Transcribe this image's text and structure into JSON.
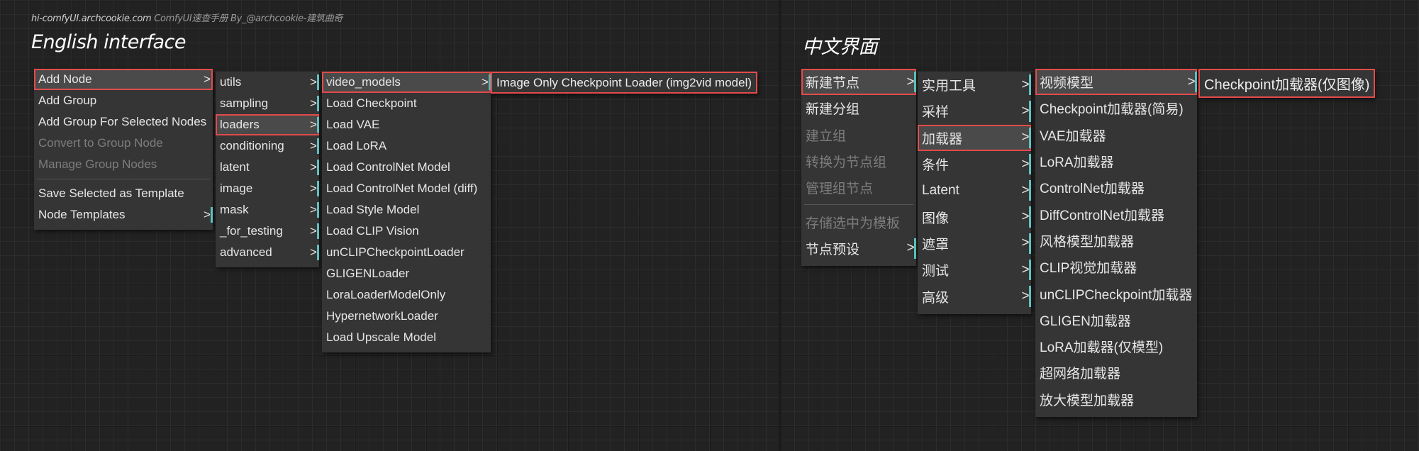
{
  "credit": {
    "site": "hi-comfyUI.archcookie.com",
    "rest": " ComfyUI速查手册  By_@archcookie-建筑曲奇"
  },
  "english": {
    "heading": "English interface",
    "context_menu": [
      {
        "label": "Add Node",
        "arrow": ">",
        "highlighted": true,
        "boxed": true
      },
      {
        "label": "Add Group"
      },
      {
        "label": "Add Group For Selected Nodes"
      },
      {
        "label": "Convert to Group Node",
        "disabled": true
      },
      {
        "label": "Manage Group Nodes",
        "disabled": true
      },
      {
        "label": "Save Selected as Template"
      },
      {
        "label": "Node Templates",
        "arrow": ">",
        "bar": true
      }
    ],
    "categories": [
      {
        "label": "utils",
        "arrow": ">",
        "bar": true
      },
      {
        "label": "sampling",
        "arrow": ">",
        "bar": true
      },
      {
        "label": "loaders",
        "arrow": ">",
        "bar": true,
        "boxed": true,
        "highlighted": true
      },
      {
        "label": "conditioning",
        "arrow": ">",
        "bar": true
      },
      {
        "label": "latent",
        "arrow": ">",
        "bar": true
      },
      {
        "label": "image",
        "arrow": ">",
        "bar": true
      },
      {
        "label": "mask",
        "arrow": ">",
        "bar": true
      },
      {
        "label": "_for_testing",
        "arrow": ">",
        "bar": true
      },
      {
        "label": "advanced",
        "arrow": ">",
        "bar": true
      }
    ],
    "loaders": [
      {
        "label": "video_models",
        "arrow": ">",
        "bar": true,
        "boxed": true,
        "highlighted": true
      },
      {
        "label": "Load Checkpoint"
      },
      {
        "label": "Load VAE"
      },
      {
        "label": "Load LoRA"
      },
      {
        "label": "Load ControlNet Model"
      },
      {
        "label": "Load ControlNet Model (diff)"
      },
      {
        "label": "Load Style Model"
      },
      {
        "label": "Load CLIP Vision"
      },
      {
        "label": "unCLIPCheckpointLoader"
      },
      {
        "label": "GLIGENLoader"
      },
      {
        "label": "LoraLoaderModelOnly"
      },
      {
        "label": "HypernetworkLoader"
      },
      {
        "label": "Load Upscale Model"
      }
    ],
    "result": "Image Only Checkpoint Loader (img2vid model)"
  },
  "chinese": {
    "heading": "中文界面",
    "context_menu": [
      {
        "label": "新建节点",
        "arrow": ">",
        "highlighted": true,
        "boxed": true,
        "bar": true
      },
      {
        "label": "新建分组"
      },
      {
        "label": "建立组",
        "disabled": true
      },
      {
        "label": "转换为节点组",
        "disabled": true
      },
      {
        "label": "管理组节点",
        "disabled": true
      },
      {
        "label": "存储选中为模板",
        "disabled": true
      },
      {
        "label": "节点预设",
        "arrow": ">",
        "bar": true
      }
    ],
    "categories": [
      {
        "label": "实用工具",
        "arrow": ">",
        "bar": true
      },
      {
        "label": "采样",
        "arrow": ">",
        "bar": true
      },
      {
        "label": "加载器",
        "arrow": ">",
        "bar": true,
        "boxed": true,
        "highlighted": true
      },
      {
        "label": "条件",
        "arrow": ">",
        "bar": true
      },
      {
        "label": "Latent",
        "arrow": ">",
        "bar": true
      },
      {
        "label": "图像",
        "arrow": ">",
        "bar": true
      },
      {
        "label": "遮罩",
        "arrow": ">",
        "bar": true
      },
      {
        "label": "测试",
        "arrow": ">",
        "bar": true
      },
      {
        "label": "高级",
        "arrow": ">",
        "bar": true
      }
    ],
    "loaders": [
      {
        "label": "视频模型",
        "arrow": ">",
        "bar": true,
        "boxed": true,
        "highlighted": true
      },
      {
        "label": "Checkpoint加载器(简易)"
      },
      {
        "label": "VAE加载器"
      },
      {
        "label": "LoRA加载器"
      },
      {
        "label": "ControlNet加载器"
      },
      {
        "label": "DiffControlNet加载器"
      },
      {
        "label": "风格模型加载器"
      },
      {
        "label": "CLIP视觉加载器"
      },
      {
        "label": "unCLIPCheckpoint加载器"
      },
      {
        "label": "GLIGEN加载器"
      },
      {
        "label": "LoRA加载器(仅模型)"
      },
      {
        "label": "超网络加载器"
      },
      {
        "label": "放大模型加载器"
      }
    ],
    "result": "Checkpoint加载器(仅图像)"
  }
}
